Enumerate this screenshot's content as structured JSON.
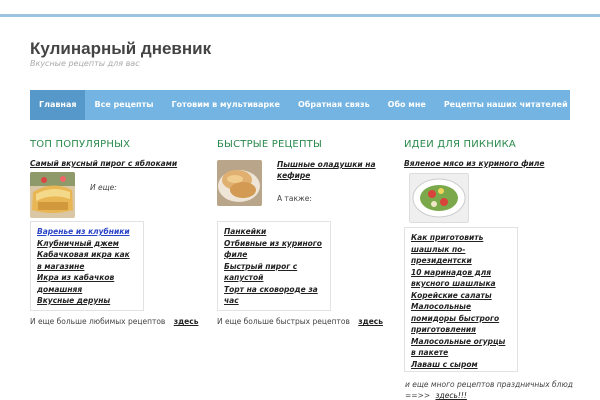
{
  "site": {
    "title": "Кулинарный дневник",
    "tagline": "Вкусные рецепты для вас"
  },
  "nav": {
    "items": [
      {
        "label": "Главная",
        "active": true
      },
      {
        "label": "Все рецепты"
      },
      {
        "label": "Готовим в мультиварке"
      },
      {
        "label": "Обратная связь"
      },
      {
        "label": "Обо мне"
      },
      {
        "label": "Рецепты наших читателей"
      }
    ]
  },
  "col1": {
    "title": "ТОП ПОПУЛЯРНЫХ",
    "featured": "Самый вкусный пирог с яблоками",
    "also": "И еще:",
    "items": [
      "Варенье из клубники",
      "Клубничный джем",
      "Кабачковая икра как в магазине",
      "Икра из кабачков домашняя",
      "Вкусные деруны"
    ],
    "more_text": "И еще больше любимых рецептов",
    "more_link": "здесь"
  },
  "col2": {
    "title": "БЫСТРЫЕ РЕЦЕПТЫ",
    "featured": "Пышные оладушки на кефире",
    "also": "А также:",
    "items": [
      "Панкейки",
      "Отбивные из куриного филе",
      "Быстрый пирог с капустой",
      "Торт на сковороде за час"
    ],
    "more_text": "И еще больше быстрых рецептов",
    "more_link": "здесь"
  },
  "col3": {
    "title": "ИДЕИ ДЛЯ ПИКНИКА",
    "featured": "Вяленое мясо из куриного филе",
    "items": [
      "Как приготовить шашлык по-президентски",
      "10 маринадов для вкусного шашлыка",
      "Корейские салаты",
      "Малосольные помидоры быстрого приготовления",
      "Малосольные огурцы в пакете",
      "Лаваш с сыром"
    ],
    "more_text": "и еще много рецептов праздничных блюд",
    "more_arrow": "==>>",
    "more_link": "здесь!!!"
  },
  "colors": {
    "nav_bg": "#74b4e2",
    "nav_active": "#5698c9",
    "heading_green": "#2b8a4c",
    "top_line": "#9cc3df"
  }
}
